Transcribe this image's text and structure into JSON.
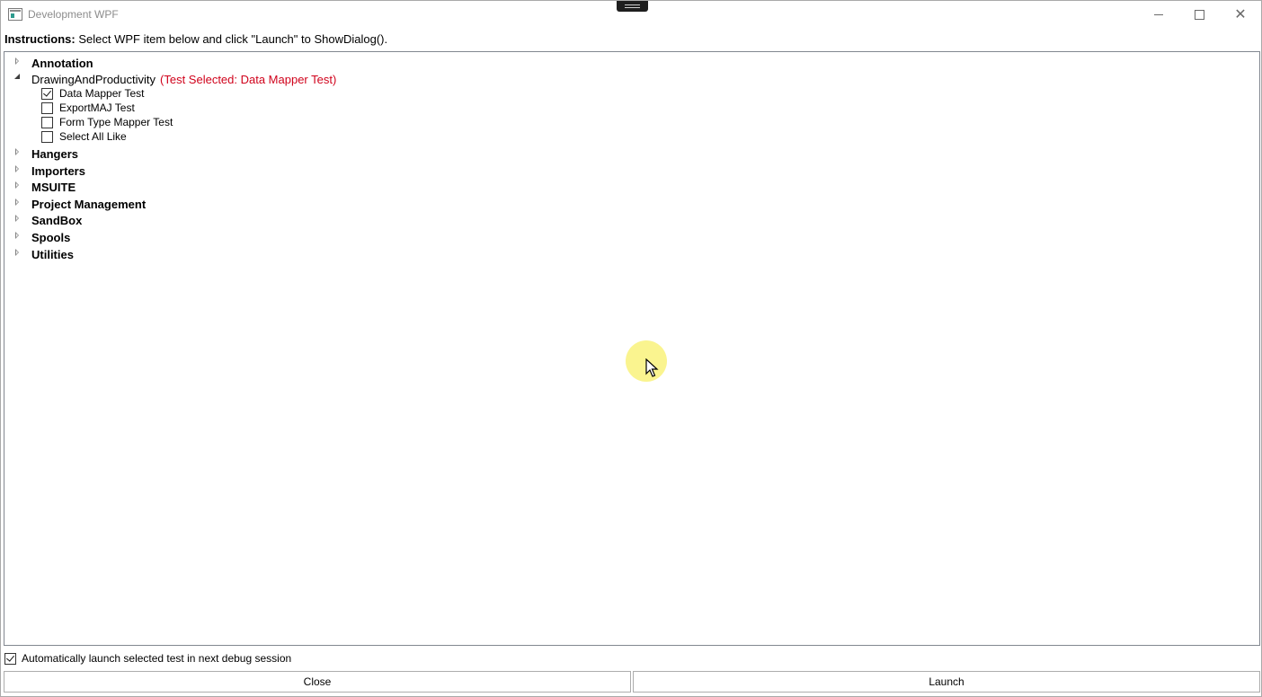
{
  "window": {
    "title": "Development WPF"
  },
  "instructions": {
    "label": "Instructions:",
    "text": " Select WPF item below and click \"Launch\" to ShowDialog()."
  },
  "tree": {
    "nodes": [
      {
        "label": "Annotation",
        "expanded": false
      },
      {
        "label": "DrawingAndProductivity",
        "expanded": true,
        "note": "(Test Selected: Data Mapper Test)",
        "children": [
          {
            "label": "Data Mapper Test",
            "checked": true
          },
          {
            "label": "ExportMAJ Test",
            "checked": false
          },
          {
            "label": "Form Type Mapper Test",
            "checked": false
          },
          {
            "label": "Select All Like",
            "checked": false
          }
        ]
      },
      {
        "label": "Hangers",
        "expanded": false
      },
      {
        "label": "Importers",
        "expanded": false
      },
      {
        "label": "MSUITE",
        "expanded": false
      },
      {
        "label": "Project Management",
        "expanded": false
      },
      {
        "label": "SandBox",
        "expanded": false
      },
      {
        "label": "Spools",
        "expanded": false
      },
      {
        "label": "Utilities",
        "expanded": false
      }
    ]
  },
  "footer": {
    "auto_launch_label": "Automatically launch selected test in next debug session",
    "auto_launch_checked": true,
    "close_label": "Close",
    "launch_label": "Launch"
  },
  "colors": {
    "note": "#d0021b",
    "border": "#828790"
  },
  "icons": [
    "app-icon",
    "minimize-icon",
    "maximize-icon",
    "close-icon",
    "expand-arrow-icon",
    "collapse-arrow-icon",
    "checkbox-icon",
    "cursor-icon"
  ]
}
